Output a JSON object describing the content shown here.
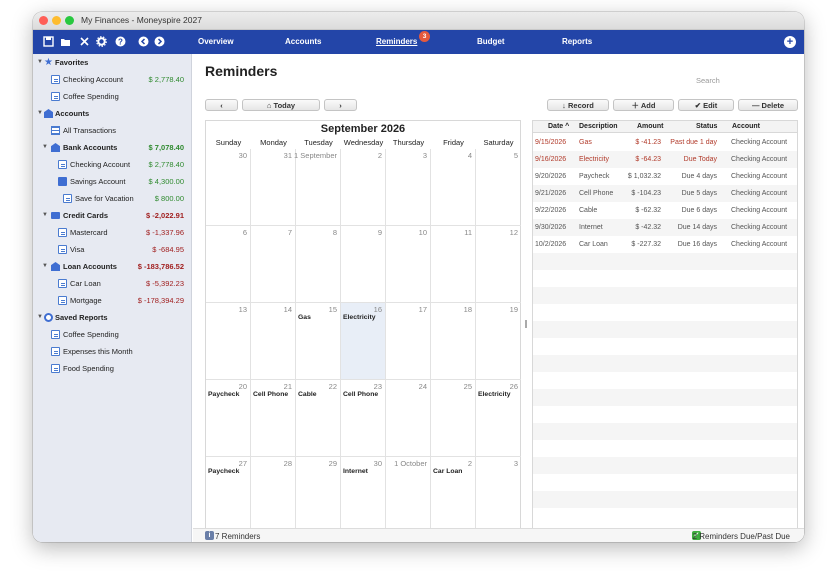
{
  "window": {
    "title": "My Finances - Moneyspire 2027"
  },
  "nav": {
    "tabs": [
      "Overview",
      "Accounts",
      "Reminders",
      "Budget",
      "Reports"
    ],
    "active": "Reminders",
    "reminders_badge": "3"
  },
  "sidebar": {
    "favorites": {
      "label": "Favorites",
      "items": [
        {
          "label": "Checking Account",
          "amount": "$ 2,778.40"
        },
        {
          "label": "Coffee Spending",
          "amount": ""
        }
      ]
    },
    "accounts": {
      "label": "Accounts",
      "all_transactions": "All Transactions",
      "bank": {
        "label": "Bank Accounts",
        "amount": "$ 7,078.40",
        "items": [
          {
            "label": "Checking Account",
            "amount": "$ 2,778.40"
          },
          {
            "label": "Savings Account",
            "amount": "$ 4,300.00"
          },
          {
            "label": "Save for Vacation",
            "amount": "$ 800.00"
          }
        ]
      },
      "credit": {
        "label": "Credit Cards",
        "amount": "$ -2,022.91",
        "items": [
          {
            "label": "Mastercard",
            "amount": "$ -1,337.96"
          },
          {
            "label": "Visa",
            "amount": "$ -684.95"
          }
        ]
      },
      "loan": {
        "label": "Loan Accounts",
        "amount": "$ -183,786.52",
        "items": [
          {
            "label": "Car Loan",
            "amount": "$ -5,392.23"
          },
          {
            "label": "Mortgage",
            "amount": "$ -178,394.29"
          }
        ]
      }
    },
    "saved_reports": {
      "label": "Saved Reports",
      "items": [
        "Coffee Spending",
        "Expenses this Month",
        "Food Spending"
      ]
    }
  },
  "main": {
    "heading": "Reminders",
    "search_placeholder": "Search",
    "nav_buttons": {
      "prev": "‹",
      "today": "Today",
      "next": "›"
    },
    "actions": {
      "record": "Record",
      "add": "Add",
      "edit": "Edit",
      "delete": "Delete"
    }
  },
  "calendar": {
    "month_title": "September 2026",
    "weekdays": [
      "Sunday",
      "Monday",
      "Tuesday",
      "Wednesday",
      "Thursday",
      "Friday",
      "Saturday"
    ],
    "weeks": [
      [
        {
          "d": "30",
          "e": ""
        },
        {
          "d": "31",
          "e": ""
        },
        {
          "d": "1 September",
          "e": ""
        },
        {
          "d": "2",
          "e": ""
        },
        {
          "d": "3",
          "e": ""
        },
        {
          "d": "4",
          "e": ""
        },
        {
          "d": "5",
          "e": ""
        }
      ],
      [
        {
          "d": "6",
          "e": ""
        },
        {
          "d": "7",
          "e": ""
        },
        {
          "d": "8",
          "e": ""
        },
        {
          "d": "9",
          "e": ""
        },
        {
          "d": "10",
          "e": ""
        },
        {
          "d": "11",
          "e": ""
        },
        {
          "d": "12",
          "e": ""
        }
      ],
      [
        {
          "d": "13",
          "e": ""
        },
        {
          "d": "14",
          "e": ""
        },
        {
          "d": "15",
          "e": "Gas"
        },
        {
          "d": "16",
          "e": "Electricity",
          "today": true
        },
        {
          "d": "17",
          "e": ""
        },
        {
          "d": "18",
          "e": ""
        },
        {
          "d": "19",
          "e": ""
        }
      ],
      [
        {
          "d": "20",
          "e": "Paycheck"
        },
        {
          "d": "21",
          "e": "Cell Phone"
        },
        {
          "d": "22",
          "e": "Cable"
        },
        {
          "d": "23",
          "e": "Cell Phone"
        },
        {
          "d": "24",
          "e": ""
        },
        {
          "d": "25",
          "e": ""
        },
        {
          "d": "26",
          "e": "Electricity"
        }
      ],
      [
        {
          "d": "27",
          "e": "Paycheck"
        },
        {
          "d": "28",
          "e": ""
        },
        {
          "d": "29",
          "e": ""
        },
        {
          "d": "30",
          "e": "Internet"
        },
        {
          "d": "1 October",
          "e": ""
        },
        {
          "d": "2",
          "e": "Car Loan"
        },
        {
          "d": "3",
          "e": ""
        }
      ]
    ]
  },
  "reminders_table": {
    "columns": [
      "Date",
      "Description",
      "Amount",
      "Status",
      "Account"
    ],
    "rows": [
      {
        "date": "9/15/2026",
        "desc": "Gas",
        "amount": "$ -41.23",
        "status": "Past due 1 day",
        "account": "Checking Account",
        "alert": true
      },
      {
        "date": "9/16/2026",
        "desc": "Electricity",
        "amount": "$ -64.23",
        "status": "Due Today",
        "account": "Checking Account",
        "alert": true
      },
      {
        "date": "9/20/2026",
        "desc": "Paycheck",
        "amount": "$ 1,032.32",
        "status": "Due 4 days",
        "account": "Checking Account",
        "alert": false
      },
      {
        "date": "9/21/2026",
        "desc": "Cell Phone",
        "amount": "$ -104.23",
        "status": "Due 5 days",
        "account": "Checking Account",
        "alert": false
      },
      {
        "date": "9/22/2026",
        "desc": "Cable",
        "amount": "$ -62.32",
        "status": "Due 6 days",
        "account": "Checking Account",
        "alert": false
      },
      {
        "date": "9/30/2026",
        "desc": "Internet",
        "amount": "$ -42.32",
        "status": "Due 14 days",
        "account": "Checking Account",
        "alert": false
      },
      {
        "date": "10/2/2026",
        "desc": "Car Loan",
        "amount": "$ -227.32",
        "status": "Due 16 days",
        "account": "Checking Account",
        "alert": false
      }
    ]
  },
  "status": {
    "left": "7 Reminders",
    "right": "2 Reminders Due/Past Due"
  },
  "colors": {
    "nav": "#2345a8",
    "positive": "#2f8a2f",
    "negative": "#a12020"
  }
}
